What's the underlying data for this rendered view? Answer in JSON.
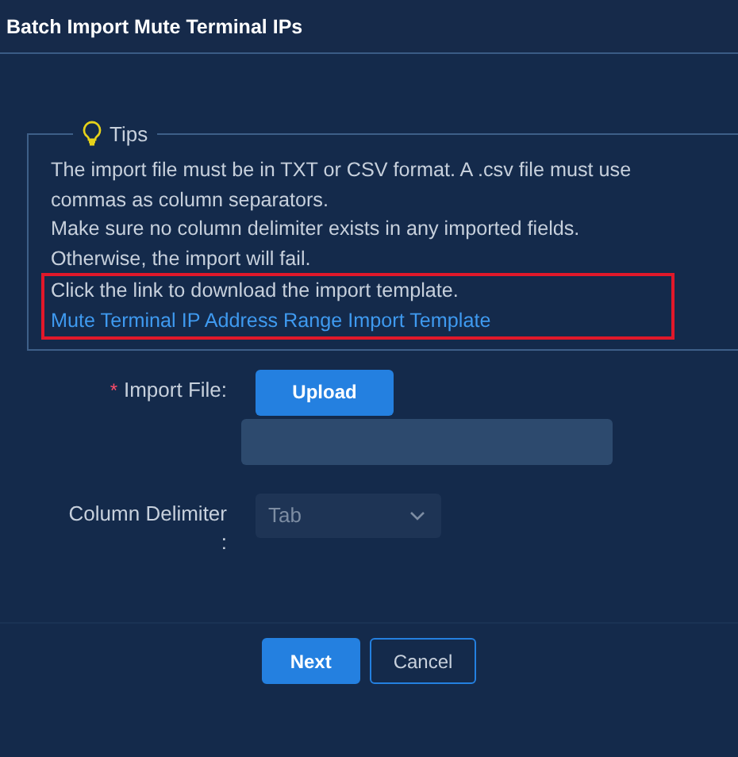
{
  "dialog": {
    "title": "Batch Import Mute Terminal IPs"
  },
  "tips": {
    "legend": "Tips",
    "paragraphs": [
      {
        "text": "The import file must be in TXT or CSV format. A .csv file must use commas as column separators.",
        "highlighted": false
      },
      {
        "text": "Make sure no column delimiter exists in any imported fields. Otherwise, the import will fail.",
        "highlighted": false
      },
      {
        "text": "Click the link to download the import template. ",
        "link": "Mute Terminal IP Address Range Import Template",
        "highlighted": true
      }
    ]
  },
  "form": {
    "fields": [
      {
        "kind": "upload",
        "label": "Import File:",
        "required_mark": "*",
        "button": "Upload"
      },
      {
        "kind": "select",
        "label": "Column Delimiter\n:",
        "value": "Tab",
        "disabled": true
      }
    ]
  },
  "buttons": [
    {
      "label": "Next",
      "primary": true
    },
    {
      "label": "Cancel",
      "primary": false
    }
  ]
}
